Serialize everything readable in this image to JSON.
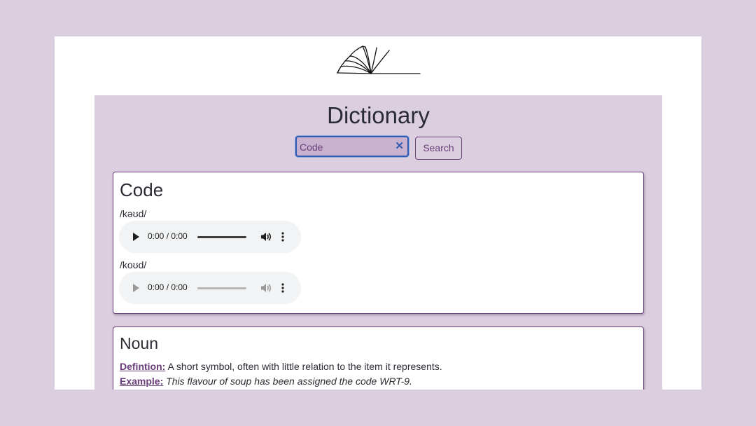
{
  "app": {
    "title": "Dictionary"
  },
  "search": {
    "value": "Code",
    "clear_glyph": "✕",
    "button_label": "Search"
  },
  "word": {
    "text": "Code",
    "phonetics": [
      {
        "text": "/kəʊd/",
        "audio": {
          "time": "0:00 / 0:00",
          "enabled": true
        }
      },
      {
        "text": "/koʊd/",
        "audio": {
          "time": "0:00 / 0:00",
          "enabled": false
        }
      }
    ]
  },
  "meanings": [
    {
      "part_of_speech": "Noun",
      "definition_label": "Defintion:",
      "definition": "A short symbol, often with little relation to the item it represents.",
      "example_label": "Example:",
      "example": "This flavour of soup has been assigned the code WRT-9."
    }
  ],
  "icons": {
    "logo": "open-book-icon",
    "play": "play-icon",
    "volume": "volume-icon",
    "more": "more-vertical-icon",
    "clear": "close-icon"
  },
  "colors": {
    "background": "#dbcfdf",
    "accent": "#6a3d7b",
    "focus_ring": "#2f5bb0",
    "card": "#ffffff"
  }
}
